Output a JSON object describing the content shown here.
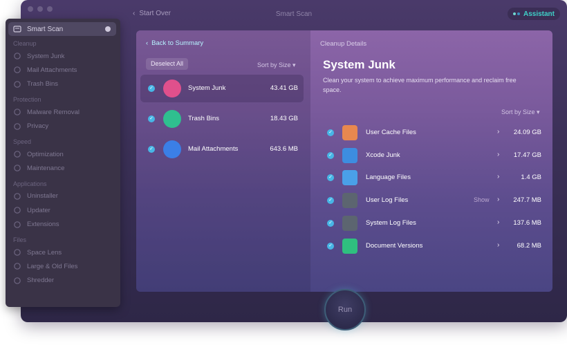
{
  "topbar": {
    "start_over": "Start Over",
    "title": "Smart Scan",
    "assistant": "Assistant"
  },
  "sidebar": {
    "active": {
      "label": "Smart Scan",
      "icon": "smart-scan-icon"
    },
    "sections": [
      {
        "title": "Cleanup",
        "items": [
          {
            "label": "System Junk",
            "icon": "system-junk-icon"
          },
          {
            "label": "Mail Attachments",
            "icon": "mail-icon"
          },
          {
            "label": "Trash Bins",
            "icon": "trash-icon"
          }
        ]
      },
      {
        "title": "Protection",
        "items": [
          {
            "label": "Malware Removal",
            "icon": "biohazard-icon"
          },
          {
            "label": "Privacy",
            "icon": "hand-icon"
          }
        ]
      },
      {
        "title": "Speed",
        "items": [
          {
            "label": "Optimization",
            "icon": "sliders-icon"
          },
          {
            "label": "Maintenance",
            "icon": "wrench-icon"
          }
        ]
      },
      {
        "title": "Applications",
        "items": [
          {
            "label": "Uninstaller",
            "icon": "uninstaller-icon"
          },
          {
            "label": "Updater",
            "icon": "updater-icon"
          },
          {
            "label": "Extensions",
            "icon": "extensions-icon"
          }
        ]
      },
      {
        "title": "Files",
        "items": [
          {
            "label": "Space Lens",
            "icon": "space-lens-icon"
          },
          {
            "label": "Large & Old Files",
            "icon": "folder-icon"
          },
          {
            "label": "Shredder",
            "icon": "shredder-icon"
          }
        ]
      }
    ]
  },
  "panel": {
    "back": "Back to Summary",
    "deselect": "Deselect All",
    "sort_left": "Sort by Size ▾",
    "categories": [
      {
        "name": "System Junk",
        "size": "43.41 GB",
        "color": "#e0508c"
      },
      {
        "name": "Trash Bins",
        "size": "18.43 GB",
        "color": "#2fbf8f"
      },
      {
        "name": "Mail Attachments",
        "size": "643.6 MB",
        "color": "#3b7fe6"
      }
    ],
    "details_title": "Cleanup Details",
    "heading": "System Junk",
    "description": "Clean your system to achieve maximum performance and reclaim free space.",
    "sort_right": "Sort by Size ▾",
    "items": [
      {
        "name": "User Cache Files",
        "show": "",
        "size": "24.09 GB",
        "icon": "user-cache-icon",
        "color": "#e8884f"
      },
      {
        "name": "Xcode Junk",
        "show": "",
        "size": "17.47 GB",
        "icon": "xcode-icon",
        "color": "#3d8de0"
      },
      {
        "name": "Language Files",
        "show": "",
        "size": "1.4 GB",
        "icon": "language-icon",
        "color": "#4aa0e8"
      },
      {
        "name": "User Log Files",
        "show": "Show",
        "size": "247.7 MB",
        "icon": "log-icon",
        "color": "#5c6570"
      },
      {
        "name": "System Log Files",
        "show": "",
        "size": "137.6 MB",
        "icon": "system-log-icon",
        "color": "#5c6570"
      },
      {
        "name": "Document Versions",
        "show": "",
        "size": "68.2 MB",
        "icon": "document-versions-icon",
        "color": "#2fbf7f"
      }
    ]
  },
  "run": "Run",
  "colors": {
    "accent_check": "#48b6e6",
    "assistant": "#3fd3c9"
  }
}
